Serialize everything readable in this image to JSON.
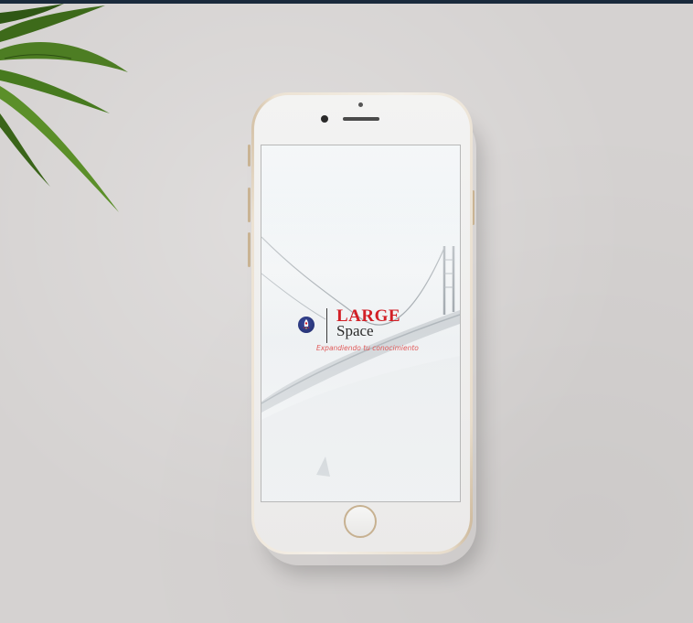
{
  "colors": {
    "background": "#d5d2d1",
    "top_bar": "#1a2a3c",
    "phone_gold": "#cdb89a",
    "logo_red": "#d21f26",
    "tagline_red": "#e05a5a"
  },
  "app_splash": {
    "logo_title": "LARGE",
    "logo_subtitle": "Space",
    "tagline": "Expandiendo tu conocimiento",
    "emblem_icon": "rocket-emblem-icon"
  },
  "decor": {
    "plant_icon": "plant-leaves-icon",
    "background_image": "bridge-in-fog-image"
  }
}
